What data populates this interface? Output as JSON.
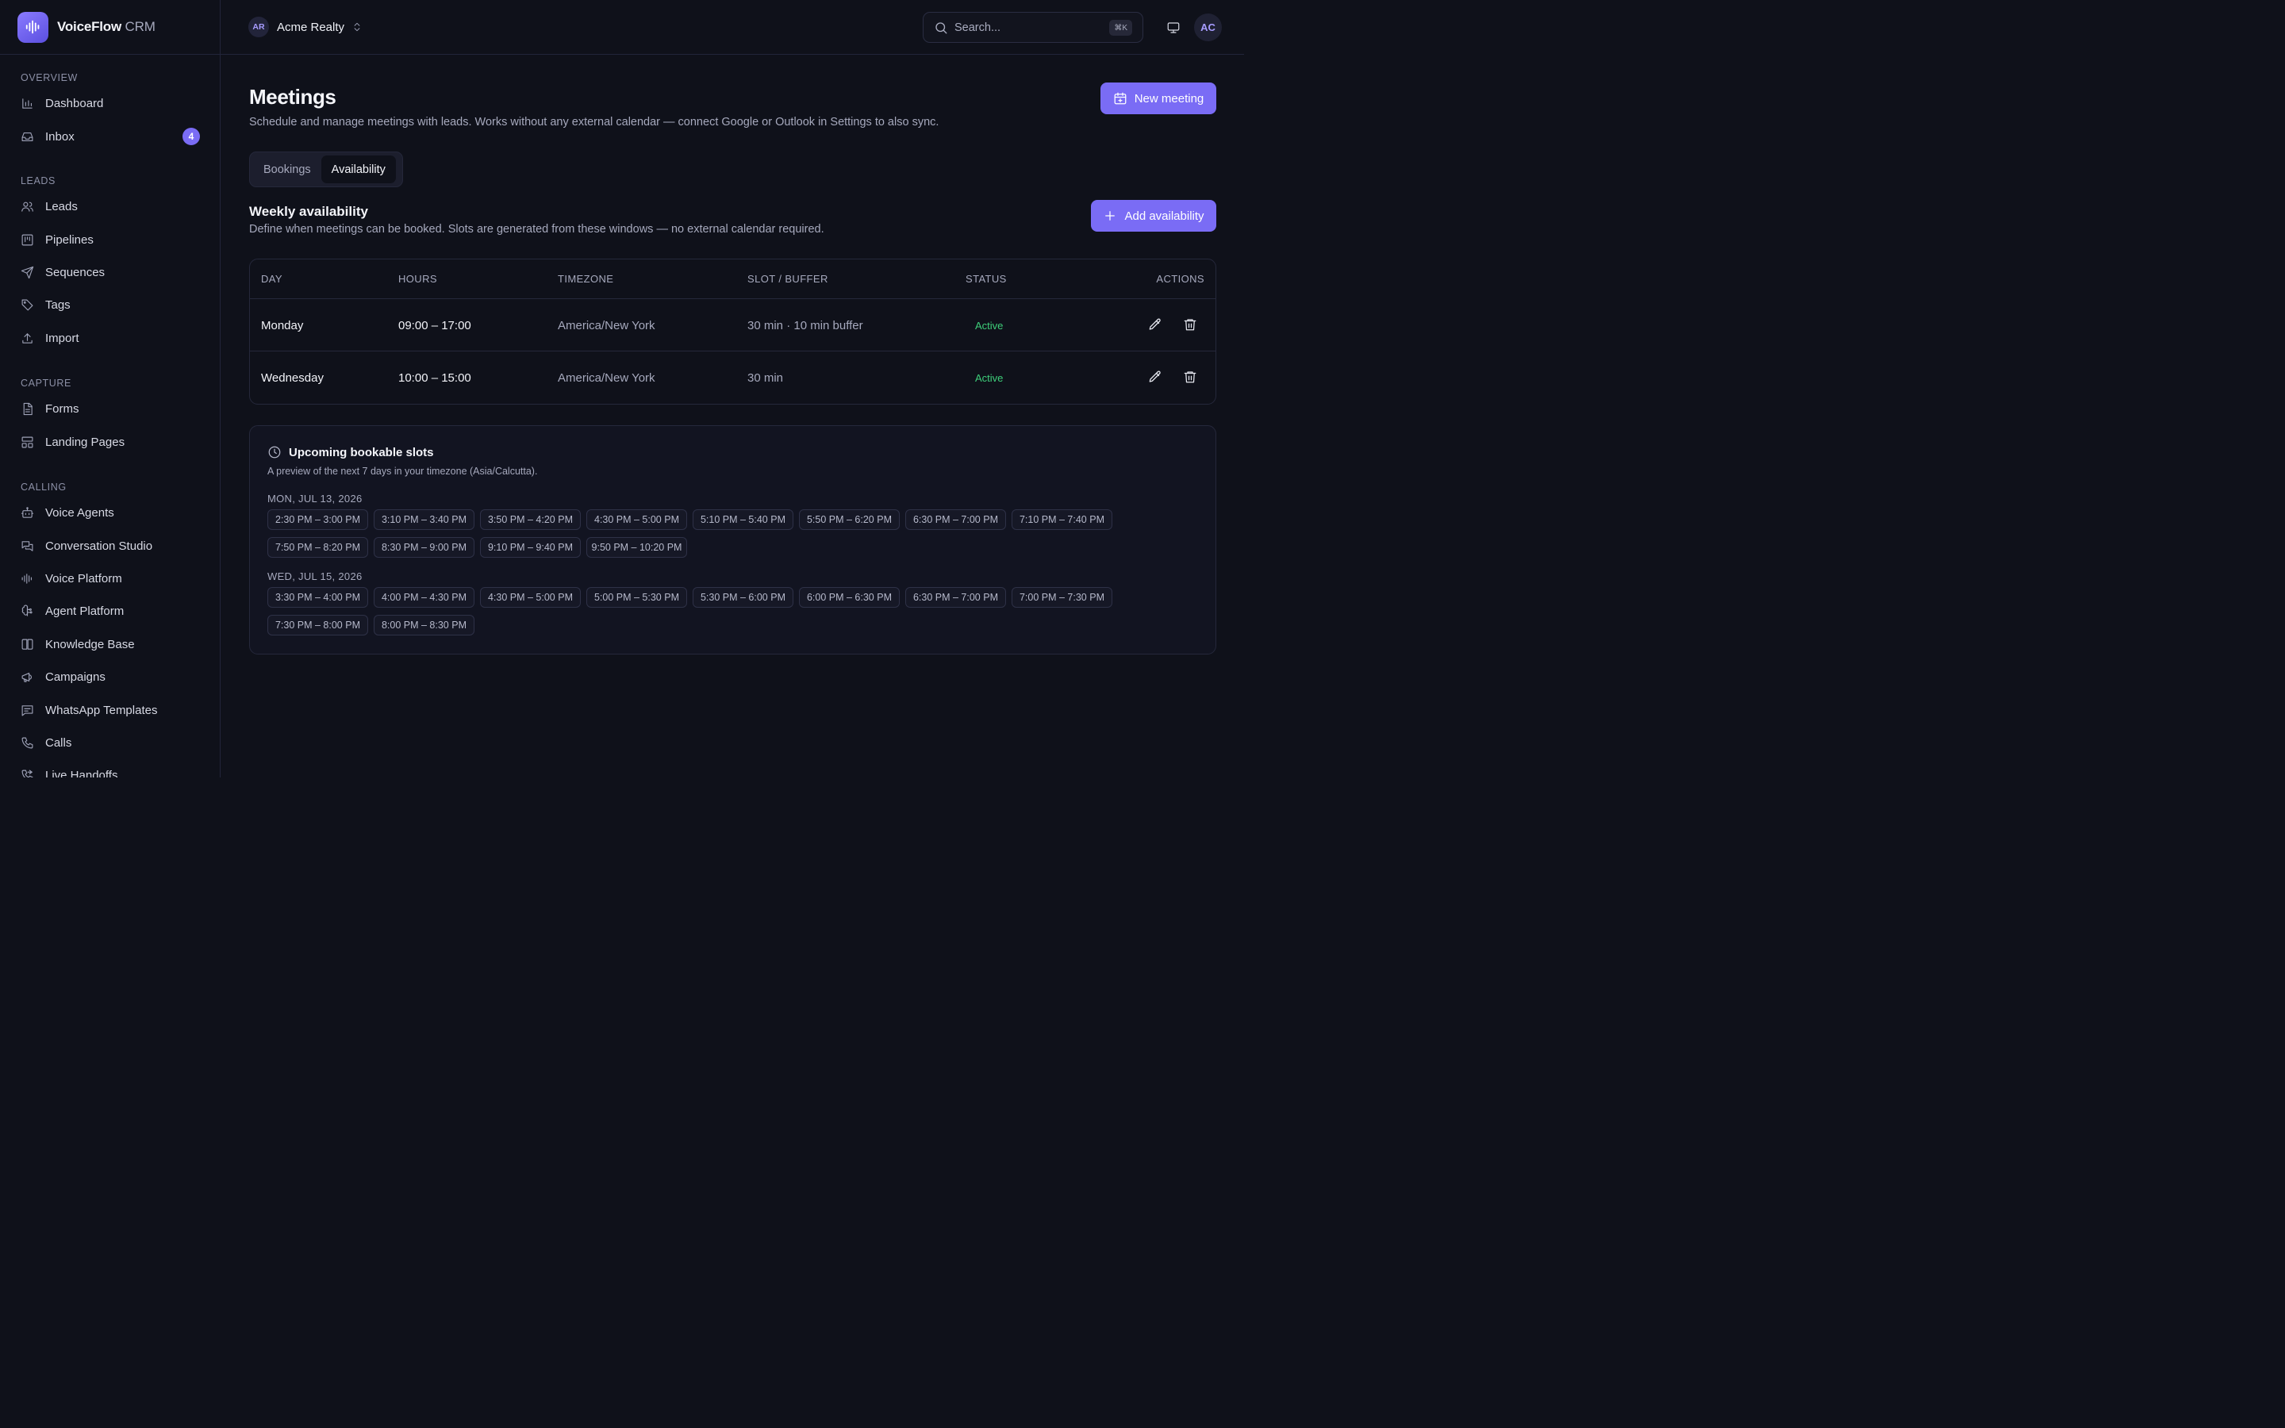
{
  "brand": {
    "name": "VoiceFlow",
    "suffix": "CRM"
  },
  "sidebar": {
    "sections": [
      {
        "heading": "OVERVIEW",
        "items": [
          {
            "label": "Dashboard",
            "icon": "bar-chart-icon"
          },
          {
            "label": "Inbox",
            "icon": "inbox-icon",
            "badge": "4"
          }
        ]
      },
      {
        "heading": "LEADS",
        "items": [
          {
            "label": "Leads",
            "icon": "users-icon"
          },
          {
            "label": "Pipelines",
            "icon": "kanban-icon"
          },
          {
            "label": "Sequences",
            "icon": "send-icon"
          },
          {
            "label": "Tags",
            "icon": "tags-icon"
          },
          {
            "label": "Import",
            "icon": "upload-icon"
          }
        ]
      },
      {
        "heading": "CAPTURE",
        "items": [
          {
            "label": "Forms",
            "icon": "file-text-icon"
          },
          {
            "label": "Landing Pages",
            "icon": "layout-icon"
          }
        ]
      },
      {
        "heading": "CALLING",
        "items": [
          {
            "label": "Voice Agents",
            "icon": "bot-icon"
          },
          {
            "label": "Conversation Studio",
            "icon": "messages-icon"
          },
          {
            "label": "Voice Platform",
            "icon": "audio-lines-icon"
          },
          {
            "label": "Agent Platform",
            "icon": "brain-icon"
          },
          {
            "label": "Knowledge Base",
            "icon": "book-icon"
          },
          {
            "label": "Campaigns",
            "icon": "megaphone-icon"
          },
          {
            "label": "WhatsApp Templates",
            "icon": "message-square-icon"
          },
          {
            "label": "Calls",
            "icon": "phone-icon"
          },
          {
            "label": "Live Handoffs",
            "icon": "phone-forward-icon"
          }
        ]
      }
    ]
  },
  "topbar": {
    "org_initials": "AR",
    "org_name": "Acme Realty",
    "search_placeholder": "Search...",
    "search_shortcut": "⌘K",
    "user_initials": "AC"
  },
  "page": {
    "title": "Meetings",
    "subtitle": "Schedule and manage meetings with leads. Works without any external calendar — connect Google or Outlook in Settings to also sync.",
    "new_meeting_label": "New meeting",
    "tabs": [
      {
        "label": "Bookings",
        "active": false
      },
      {
        "label": "Availability",
        "active": true
      }
    ]
  },
  "availability": {
    "title": "Weekly availability",
    "subtitle": "Define when meetings can be booked. Slots are generated from these windows — no external calendar required.",
    "add_label": "Add availability",
    "columns": {
      "day": "DAY",
      "hours": "HOURS",
      "timezone": "TIMEZONE",
      "slot": "SLOT / BUFFER",
      "status": "STATUS",
      "actions": "ACTIONS"
    },
    "rows": [
      {
        "day": "Monday",
        "hours": "09:00 – 17:00",
        "timezone": "America/New York",
        "slot": "30 min · 10 min buffer",
        "status": "Active"
      },
      {
        "day": "Wednesday",
        "hours": "10:00 – 15:00",
        "timezone": "America/New York",
        "slot": "30 min",
        "status": "Active"
      }
    ]
  },
  "slots": {
    "title": "Upcoming bookable slots",
    "subtitle": "A preview of the next 7 days in your timezone (Asia/Calcutta).",
    "days": [
      {
        "label": "MON, JUL 13, 2026",
        "slots": [
          "2:30 PM – 3:00 PM",
          "3:10 PM – 3:40 PM",
          "3:50 PM – 4:20 PM",
          "4:30 PM – 5:00 PM",
          "5:10 PM – 5:40 PM",
          "5:50 PM – 6:20 PM",
          "6:30 PM – 7:00 PM",
          "7:10 PM – 7:40 PM",
          "7:50 PM – 8:20 PM",
          "8:30 PM – 9:00 PM",
          "9:10 PM – 9:40 PM",
          "9:50 PM – 10:20 PM"
        ]
      },
      {
        "label": "WED, JUL 15, 2026",
        "slots": [
          "3:30 PM – 4:00 PM",
          "4:00 PM – 4:30 PM",
          "4:30 PM – 5:00 PM",
          "5:00 PM – 5:30 PM",
          "5:30 PM – 6:00 PM",
          "6:00 PM – 6:30 PM",
          "6:30 PM – 7:00 PM",
          "7:00 PM – 7:30 PM",
          "7:30 PM – 8:00 PM",
          "8:00 PM – 8:30 PM"
        ]
      }
    ]
  },
  "colors": {
    "accent": "#7a6cf5",
    "active_status": "#3ecf7a",
    "background": "#0f111a"
  }
}
